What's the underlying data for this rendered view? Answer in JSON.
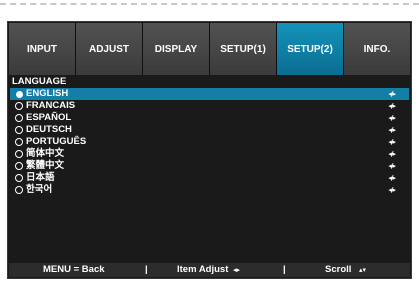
{
  "tabs": [
    {
      "label": "INPUT",
      "active": false
    },
    {
      "label": "ADJUST",
      "active": false
    },
    {
      "label": "DISPLAY",
      "active": false
    },
    {
      "label": "SETUP(1)",
      "active": false
    },
    {
      "label": "SETUP(2)",
      "active": true
    },
    {
      "label": "INFO.",
      "active": false
    }
  ],
  "section_title": "LANGUAGE",
  "languages": [
    {
      "label": "ENGLISH",
      "selected": true,
      "arrow": "◂/▸"
    },
    {
      "label": "FRANCAIS",
      "selected": false,
      "arrow": "◂/▸"
    },
    {
      "label": "ESPAÑOL",
      "selected": false,
      "arrow": "◂/▸"
    },
    {
      "label": "DEUTSCH",
      "selected": false,
      "arrow": "◂/▸"
    },
    {
      "label": "PORTUGUÊS",
      "selected": false,
      "arrow": "◂/▸"
    },
    {
      "label": "简体中文",
      "selected": false,
      "arrow": "◂/▸"
    },
    {
      "label": "繁體中文",
      "selected": false,
      "arrow": "◂/▸"
    },
    {
      "label": "日本語",
      "selected": false,
      "arrow": "◂/▸"
    },
    {
      "label": "한국어",
      "selected": false,
      "arrow": "◂/▸"
    }
  ],
  "footer": {
    "menu_back": "MENU = Back",
    "sep1": "|",
    "item_adjust": "Item Adjust",
    "item_adjust_icon": "◂▸",
    "sep2": "|",
    "scroll": "Scroll",
    "scroll_icon": "▴▾"
  },
  "colors": {
    "accent": "#147ea6",
    "background": "#1a1a1a",
    "tab": "#474747"
  }
}
